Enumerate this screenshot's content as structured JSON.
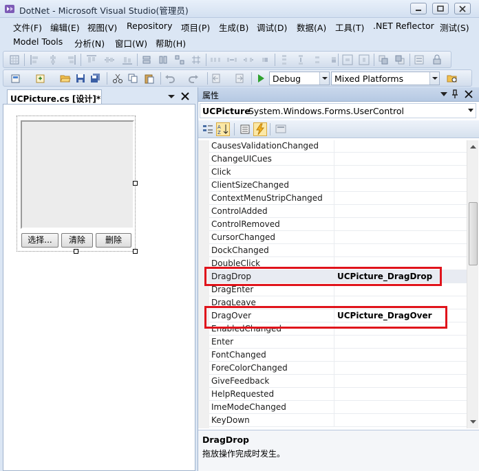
{
  "window": {
    "title": "DotNet - Microsoft Visual Studio(管理员)"
  },
  "menu": {
    "row1": [
      "文件(F)",
      "编辑(E)",
      "视图(V)",
      "Repository",
      "项目(P)",
      "生成(B)",
      "调试(D)",
      "数据(A)",
      "工具(T)",
      ".NET Reflector",
      "测试(S)"
    ],
    "row2": [
      "Model Tools",
      "分析(N)",
      "窗口(W)",
      "帮助(H)"
    ]
  },
  "toolbar": {
    "config": "Debug",
    "platform": "Mixed Platforms"
  },
  "designer": {
    "tab_label": "UCPicture.cs [设计]*",
    "buttons": [
      "选择...",
      "清除",
      "删除"
    ]
  },
  "properties": {
    "title": "属性",
    "object_name": "UCPicture",
    "object_type": "System.Windows.Forms.UserControl",
    "events": [
      {
        "name": "CausesValidationChanged",
        "value": ""
      },
      {
        "name": "ChangeUICues",
        "value": ""
      },
      {
        "name": "Click",
        "value": ""
      },
      {
        "name": "ClientSizeChanged",
        "value": ""
      },
      {
        "name": "ContextMenuStripChanged",
        "value": ""
      },
      {
        "name": "ControlAdded",
        "value": ""
      },
      {
        "name": "ControlRemoved",
        "value": ""
      },
      {
        "name": "CursorChanged",
        "value": ""
      },
      {
        "name": "DockChanged",
        "value": ""
      },
      {
        "name": "DoubleClick",
        "value": ""
      },
      {
        "name": "DragDrop",
        "value": "UCPicture_DragDrop"
      },
      {
        "name": "DragEnter",
        "value": ""
      },
      {
        "name": "DragLeave",
        "value": ""
      },
      {
        "name": "DragOver",
        "value": "UCPicture_DragOver"
      },
      {
        "name": "EnabledChanged",
        "value": ""
      },
      {
        "name": "Enter",
        "value": ""
      },
      {
        "name": "FontChanged",
        "value": ""
      },
      {
        "name": "ForeColorChanged",
        "value": ""
      },
      {
        "name": "GiveFeedback",
        "value": ""
      },
      {
        "name": "HelpRequested",
        "value": ""
      },
      {
        "name": "ImeModeChanged",
        "value": ""
      },
      {
        "name": "KeyDown",
        "value": ""
      }
    ],
    "description_title": "DragDrop",
    "description_text": "拖放操作完成时发生。"
  },
  "colors": {
    "highlight": "#e0131b",
    "chrome": "#dbe6f4"
  }
}
